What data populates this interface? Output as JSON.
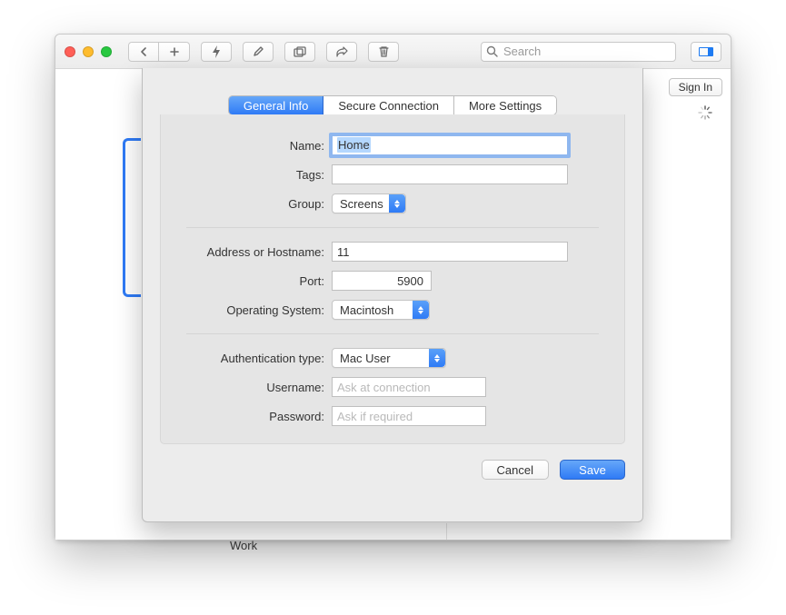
{
  "toolbar": {
    "search_placeholder": "Search"
  },
  "header": {
    "signin_label": "Sign In"
  },
  "groups": {
    "work_label": "Work"
  },
  "dialog": {
    "tabs": {
      "general": "General Info",
      "secure": "Secure Connection",
      "more": "More Settings"
    },
    "labels": {
      "name": "Name:",
      "tags": "Tags:",
      "group": "Group:",
      "address": "Address or Hostname:",
      "port": "Port:",
      "os": "Operating System:",
      "auth_type": "Authentication type:",
      "username": "Username:",
      "password": "Password:"
    },
    "values": {
      "name": "Home",
      "tags": "",
      "group": "Screens",
      "address": "11",
      "port": "5900",
      "os": "Macintosh",
      "auth_type": "Mac User",
      "username": "",
      "password": ""
    },
    "placeholders": {
      "username": "Ask at connection",
      "password": "Ask if required"
    },
    "buttons": {
      "cancel": "Cancel",
      "save": "Save"
    }
  }
}
